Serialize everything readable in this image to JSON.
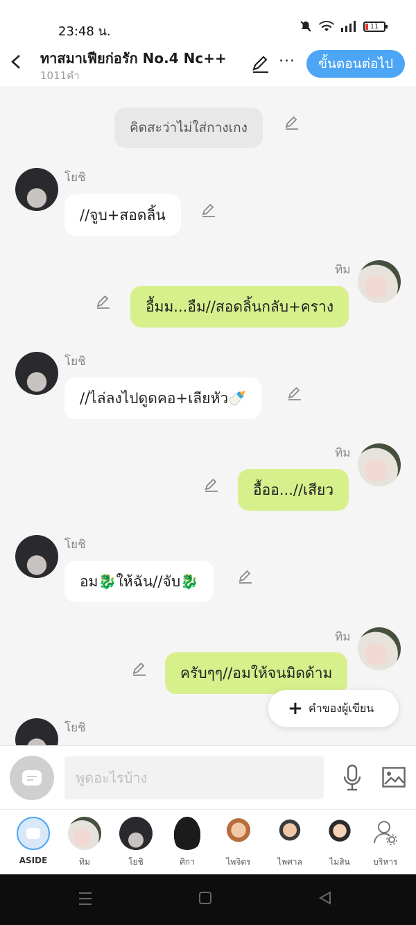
{
  "status_bar": {
    "time": "23:48 น.",
    "battery": "11"
  },
  "header": {
    "title": "ทาสมาเฟียก่อรัก No.4 Nc++",
    "word_count": "1011คำ",
    "next_button": "ขั้นตอนต่อไป",
    "more": "···"
  },
  "messages": [
    {
      "type": "narration",
      "text": "คิดสะว่าไม่ใส่กางเกง"
    },
    {
      "type": "left",
      "name": "โยชิ",
      "text": "//จูบ+สอดลิ้น"
    },
    {
      "type": "right",
      "name": "ทิม",
      "text": "อื้มม...อืม//สอดลิ้นกลับ+คราง"
    },
    {
      "type": "left",
      "name": "โยชิ",
      "text": "//ไล่ลงไปดูดคอ+เลียหัว🍼"
    },
    {
      "type": "right",
      "name": "ทิม",
      "text": "อื้ออ...//เสียว"
    },
    {
      "type": "left",
      "name": "โยชิ",
      "text": "อม🐉ให้ฉัน//จับ🐉"
    },
    {
      "type": "right",
      "name": "ทิม",
      "text": "ครับๆๆ//อมให้จนมิดด้าม"
    },
    {
      "type": "left",
      "name": "โยชิ",
      "text": ""
    }
  ],
  "fab": {
    "label": "คำของผู้เขียน"
  },
  "input": {
    "placeholder": "พูดอะไรบ้าง"
  },
  "characters": [
    {
      "label": "ASIDE"
    },
    {
      "label": "ทิม"
    },
    {
      "label": "โยชิ"
    },
    {
      "label": "ศิกา"
    },
    {
      "label": "ไพจิตร"
    },
    {
      "label": "ไพศาล"
    },
    {
      "label": "ไมสิน"
    },
    {
      "label": "บริหาร"
    }
  ]
}
